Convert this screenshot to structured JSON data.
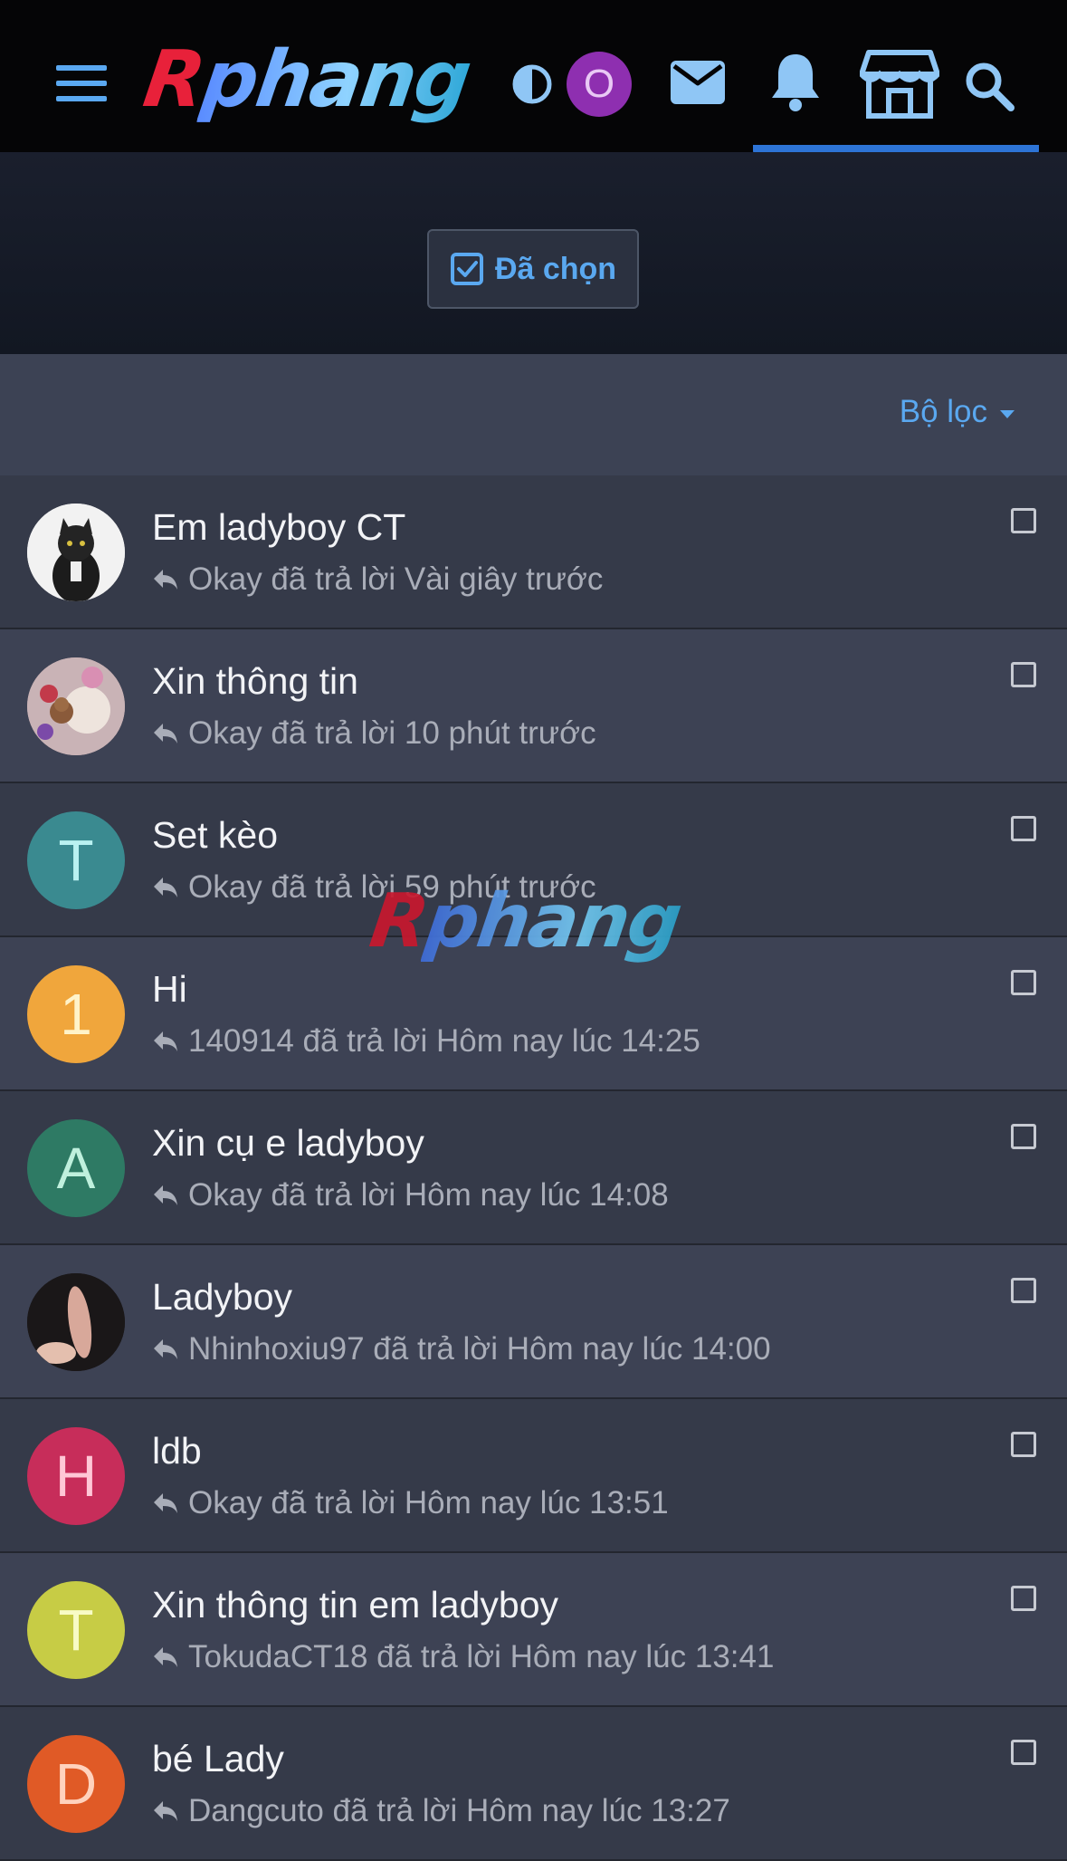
{
  "header": {
    "logo_text_first": "R",
    "logo_text_rest": "phang",
    "avatar_letter": "O",
    "icons": [
      "menu-icon",
      "contrast-icon",
      "mail-icon",
      "bell-icon",
      "store-icon",
      "search-icon"
    ]
  },
  "filter": {
    "selected_label": "Đã chọn",
    "filter_label": "Bộ lọc"
  },
  "conversations": [
    {
      "title": "Em ladyboy CT",
      "meta": "Okay đã trả lời Vài giây trước",
      "avatar": "",
      "avatar_type": "photo-cat",
      "color": "#e9e9e9"
    },
    {
      "title": "Xin thông tin",
      "meta": "Okay đã trả lời 10 phút trước",
      "avatar": "",
      "avatar_type": "photo-flowers",
      "color": "#c7a6a6"
    },
    {
      "title": "Set kèo",
      "meta": "Okay đã trả lời 59 phút trước",
      "avatar": "T",
      "avatar_type": "letter",
      "color": "#3a8a90",
      "text_color": "#b9f1f1"
    },
    {
      "title": "Hi",
      "meta": "140914 đã trả lời Hôm nay lúc 14:25",
      "avatar": "1",
      "avatar_type": "letter",
      "color": "#f0a63c",
      "text_color": "#fff3c9"
    },
    {
      "title": "Xin cụ e ladyboy",
      "meta": "Okay đã trả lời Hôm nay lúc 14:08",
      "avatar": "A",
      "avatar_type": "letter",
      "color": "#2e7a64",
      "text_color": "#bff0dd"
    },
    {
      "title": "Ladyboy",
      "meta": "Nhinhoxiu97 đã trả lời Hôm nay lúc 14:00",
      "avatar": "",
      "avatar_type": "photo-dark",
      "color": "#1e1a1c"
    },
    {
      "title": "ldb",
      "meta": "Okay đã trả lời Hôm nay lúc 13:51",
      "avatar": "H",
      "avatar_type": "letter",
      "color": "#c72d5a",
      "text_color": "#ffc7d6"
    },
    {
      "title": "Xin thông tin em ladyboy",
      "meta": "TokudaCT18 đã trả lời Hôm nay lúc 13:41",
      "avatar": "T",
      "avatar_type": "letter",
      "color": "#c7cc45",
      "text_color": "#f8fbc6"
    },
    {
      "title": "bé Lady",
      "meta": "Dangcuto đã trả lời Hôm nay lúc 13:27",
      "avatar": "D",
      "avatar_type": "letter",
      "color": "#e05a26",
      "text_color": "#ffd2bd"
    }
  ],
  "watermark": {
    "first": "R",
    "rest": "phang"
  }
}
